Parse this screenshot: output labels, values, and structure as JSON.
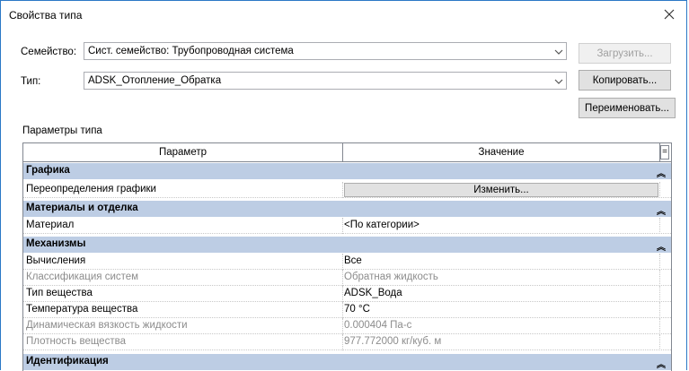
{
  "window": {
    "title": "Свойства типа"
  },
  "family": {
    "label": "Семейство:",
    "value": "Сист. семейство: Трубопроводная система"
  },
  "type": {
    "label": "Тип:",
    "value": "ADSK_Отопление_Обратка"
  },
  "buttons": {
    "load": "Загрузить...",
    "copy": "Копировать...",
    "rename": "Переименовать..."
  },
  "params_label": "Параметры типа",
  "grid": {
    "columns": [
      "Параметр",
      "Значение",
      "="
    ],
    "groups": [
      {
        "name": "Графика",
        "rows": [
          {
            "param": "Переопределения графики",
            "value": "Изменить...",
            "kind": "button"
          }
        ]
      },
      {
        "name": "Материалы и отделка",
        "rows": [
          {
            "param": "Материал",
            "value": "<По категории>"
          }
        ]
      },
      {
        "name": "Механизмы",
        "rows": [
          {
            "param": "Вычисления",
            "value": "Все"
          },
          {
            "param": "Классификация систем",
            "value": "Обратная жидкость",
            "readonly": true
          },
          {
            "param": "Тип вещества",
            "value": "ADSK_Вода"
          },
          {
            "param": "Температура вещества",
            "value": "70 °C"
          },
          {
            "param": "Динамическая вязкость жидкости",
            "value": "0.000404 Па-с",
            "readonly": true
          },
          {
            "param": "Плотность вещества",
            "value": "977.772000 кг/куб. м",
            "readonly": true
          }
        ]
      },
      {
        "name": "Идентификация",
        "rows": []
      }
    ]
  },
  "icons": {
    "close": "close-icon",
    "dropdown": "chevron-down-icon",
    "collapse": "double-chevron-up-icon"
  },
  "colors": {
    "group_bg": "#bdcde4",
    "border_accent": "#2b78c6",
    "readonly_text": "#8c8c8c"
  }
}
